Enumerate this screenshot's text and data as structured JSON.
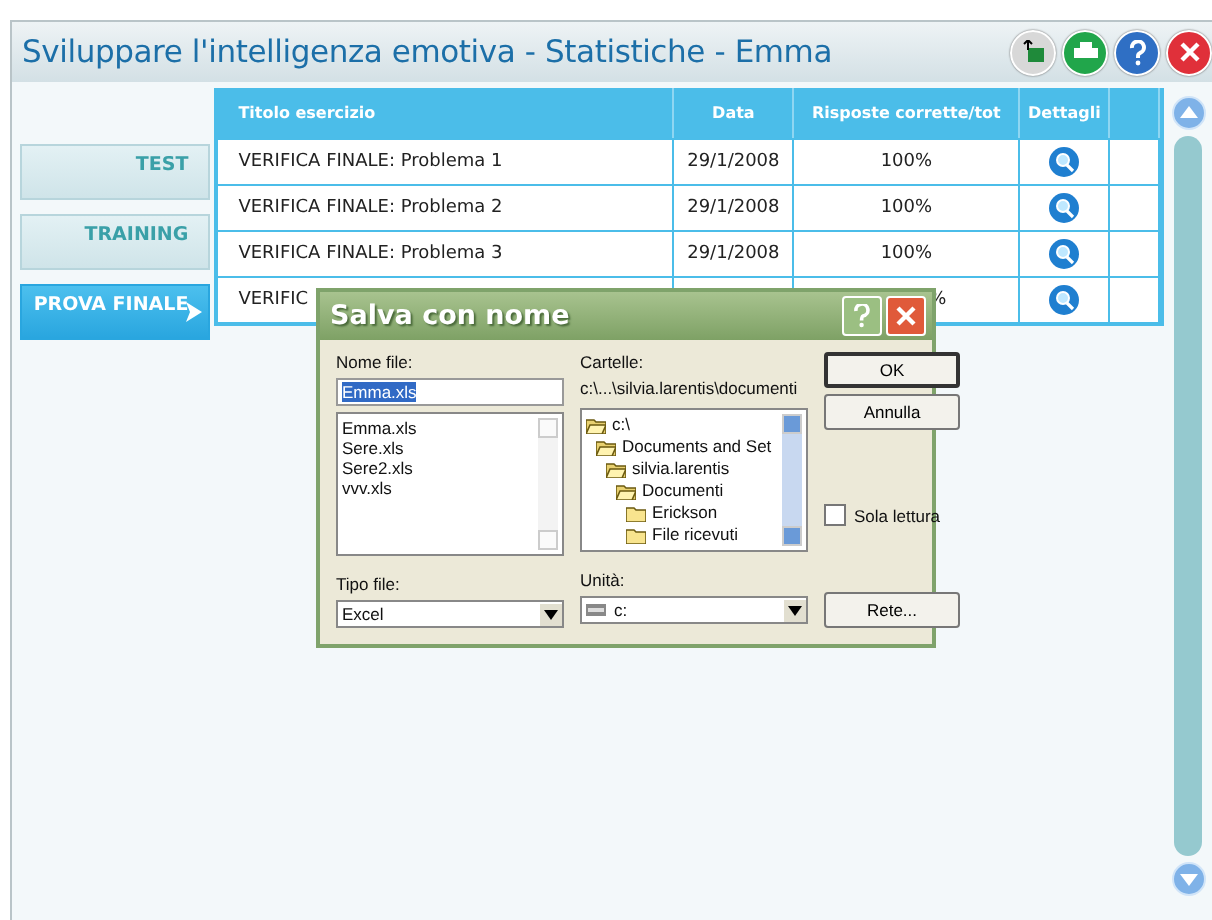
{
  "window": {
    "title": "Sviluppare l'intelligenza emotiva - Statistiche - Emma"
  },
  "toolbar": [
    {
      "kind": "export"
    },
    {
      "kind": "print"
    },
    {
      "kind": "help"
    },
    {
      "kind": "close"
    }
  ],
  "sidebar": {
    "items": [
      {
        "label": "TEST",
        "selected": false
      },
      {
        "label": "TRAINING",
        "selected": false
      },
      {
        "label": "PROVA FINALE",
        "selected": true
      }
    ]
  },
  "table": {
    "columns": [
      "Titolo esercizio",
      "Data",
      "Risposte corrette/tot",
      "Dettagli"
    ],
    "rows": [
      {
        "title": "VERIFICA FINALE: Problema 1",
        "date": "29/1/2008",
        "score": "100%"
      },
      {
        "title": "VERIFICA FINALE: Problema 2",
        "date": "29/1/2008",
        "score": "100%"
      },
      {
        "title": "VERIFICA FINALE: Problema 3",
        "date": "29/1/2008",
        "score": "100%"
      },
      {
        "title": "VERIFIC",
        "score": "%"
      }
    ]
  },
  "dialog": {
    "title": "Salva con nome",
    "file_name_label": "Nome file:",
    "file_name": "Emma.xls",
    "files": [
      "Emma.xls",
      "Sere.xls",
      "Sere2.xls",
      "vvv.xls"
    ],
    "folders_label": "Cartelle:",
    "folder_path": "c:\\...\\silvia.larentis\\documenti",
    "folders": [
      {
        "name": "c:\\",
        "open": true,
        "children": [
          {
            "name": "Documents and Set",
            "open": true,
            "children": [
              {
                "name": "silvia.larentis",
                "open": true,
                "children": [
                  {
                    "name": "Documenti",
                    "open": true,
                    "children": [
                      {
                        "name": "Erickson",
                        "open": false
                      },
                      {
                        "name": "File ricevuti",
                        "open": false
                      }
                    ]
                  }
                ]
              }
            ]
          }
        ]
      }
    ],
    "file_type_label": "Tipo file:",
    "file_type": "Excel",
    "drive_label": "Unità:",
    "drive": "c:",
    "read_only": {
      "label": "Sola lettura",
      "checked": false
    },
    "buttons": [
      "OK",
      "Annulla",
      "Rete..."
    ]
  }
}
